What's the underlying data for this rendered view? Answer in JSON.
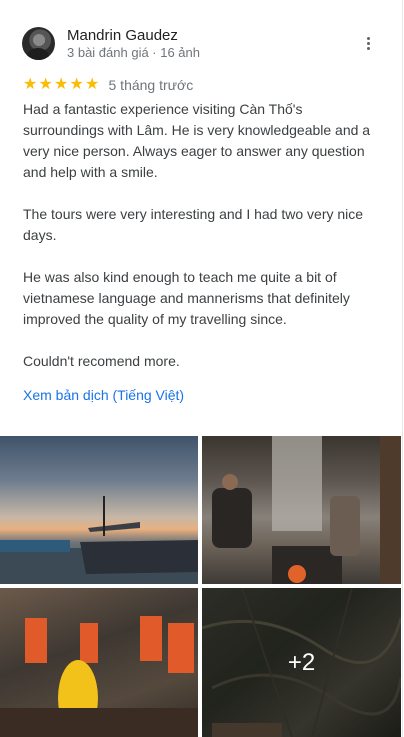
{
  "review": {
    "author_name": "Mandrin Gaudez",
    "author_meta": "3 bài đánh giá · 16 ảnh",
    "stars": 5,
    "time_ago": "5 tháng trước",
    "paragraphs": [
      "Had a fantastic experience visiting Càn Thố's surroundings with Lâm. He is very knowledgeable and a very nice person. Always eager to answer any question and help with a smile.",
      "The tours were very interesting and I had two very nice days.",
      "He was also kind enough to teach me quite a bit of vietnamese language and mannerisms that definitely improved the quality of my travelling since.",
      "Couldn't recomend more."
    ],
    "translate_link": "Xem bản dịch (Tiếng Việt)",
    "more_photos_label": "+2"
  },
  "icons": {
    "menu": "more-vert-icon",
    "star": "star-icon"
  },
  "colors": {
    "star": "#fbbc04",
    "link": "#1a73e8"
  }
}
